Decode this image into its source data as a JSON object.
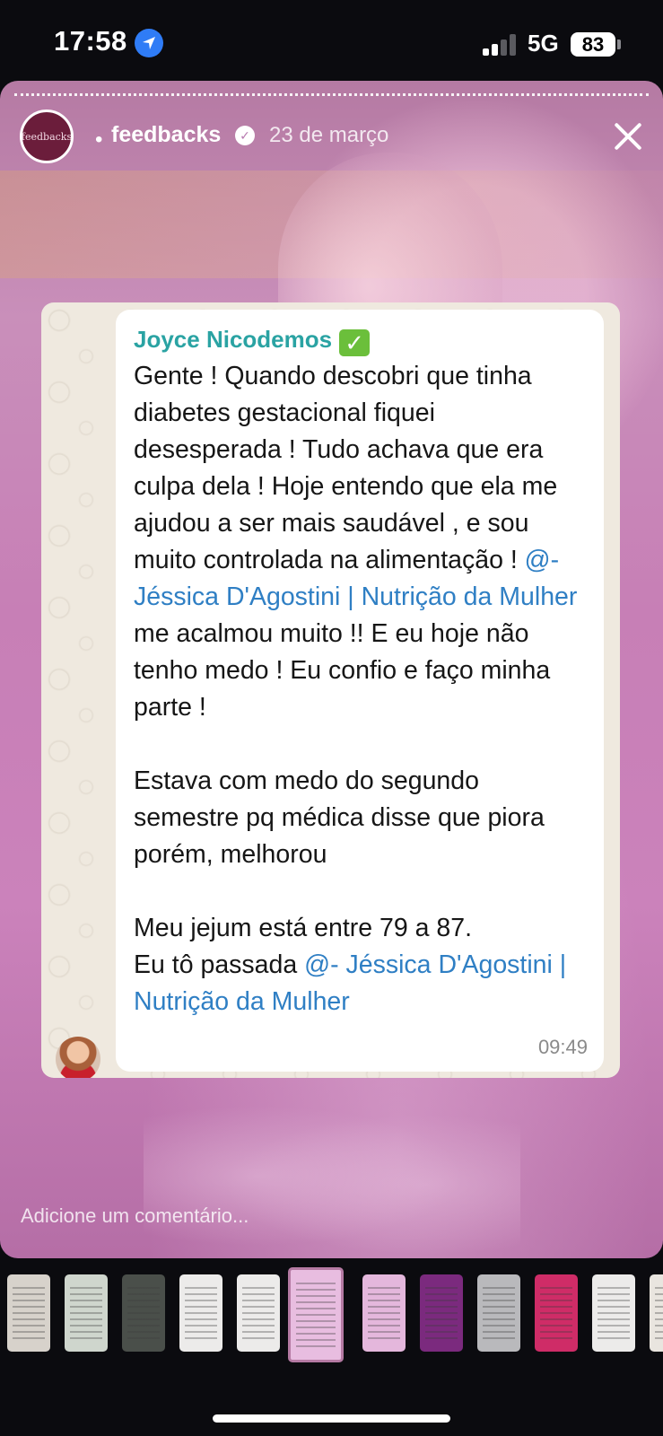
{
  "status_bar": {
    "time": "17:58",
    "network": "5G",
    "battery": "83",
    "icons": [
      "location-arrow-icon",
      "cellular-signal-icon",
      "battery-icon"
    ]
  },
  "story": {
    "account": "feedbacks",
    "avatar_text": "feedbacks",
    "separator": "•",
    "date": "23 de março",
    "verified_icon": "verified-check-icon",
    "close_icon": "close-icon",
    "comment_placeholder": "Adicione um comentário..."
  },
  "chat": {
    "sender": "Joyce Nicodemos",
    "sender_badge": "✓",
    "msg_part1": "Gente ! Quando descobri que tinha diabetes gestacional fiquei desesperada ! Tudo achava que era culpa dela ! Hoje entendo que ela me ajudou a ser mais saudável , e sou muito controlada na alimentação ! ",
    "mention_prefix": "@",
    "mention_name": "- Jéssica D'Agostini | Nutrição da Mulher",
    "msg_part2": "  me acalmou muito !! E eu hoje não tenho medo ! Eu confio e faço minha parte !\n\nEstava com medo do segundo semestre pq médica disse que piora porém, melhorou\n\nMeu jejum está entre 79 a 87.\nEu tô passada ",
    "time": "09:49"
  },
  "thumbnails": {
    "count": 12,
    "selected_index": 5,
    "colors": [
      "#d7d2cb",
      "#cfd6cd",
      "#4a4f4a",
      "#ecebea",
      "#ecebea",
      "#e8bde0",
      "#e4b7dc",
      "#7b2a7e",
      "#b9b9bc",
      "#cf2c67",
      "#ecebea",
      "#e9e5df"
    ]
  },
  "colors": {
    "story_bg": "#c98fba",
    "sender_name": "#2aa3a3",
    "mention": "#2f7fc4",
    "location_icon": "#2f7cf6"
  }
}
